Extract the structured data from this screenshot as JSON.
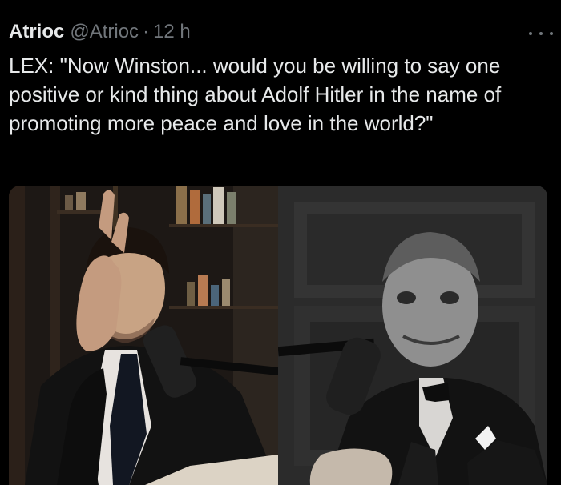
{
  "tweet": {
    "display_name": "Atrioc",
    "handle": "@Atrioc",
    "separator": "·",
    "time": "12 h",
    "more_icon": "more-horizontal-icon",
    "text": "LEX: \"Now Winston... would you be willing to say one positive or kind thing about Adolf Hitler in the name of promoting more peace and love in the world?\""
  },
  "colors": {
    "background": "#000000",
    "primary_text": "#e7e9ea",
    "secondary_text": "#71767b"
  }
}
